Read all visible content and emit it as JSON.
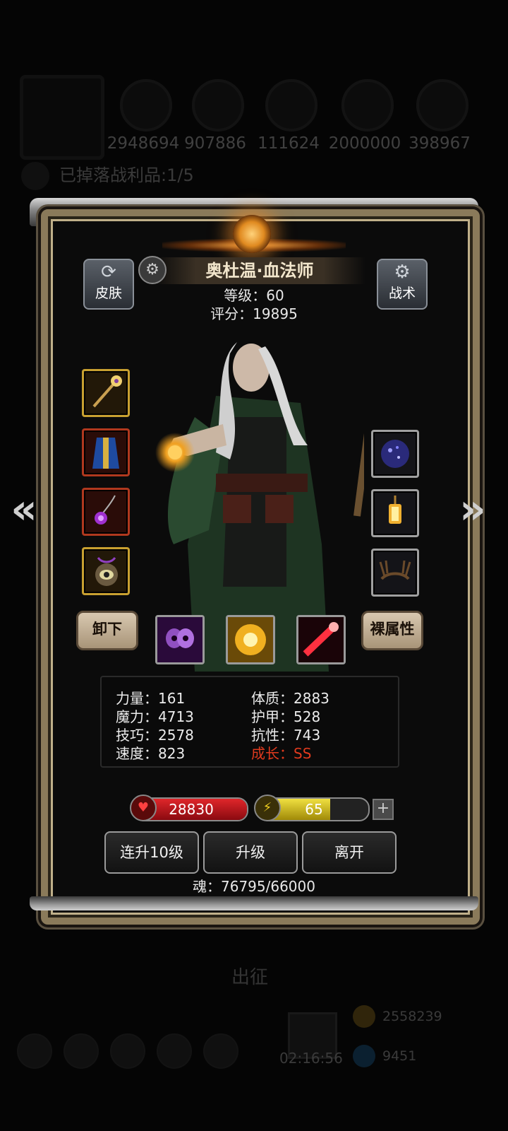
{
  "background": {
    "resources": [
      "2948694",
      "907886",
      "111624",
      "2000000",
      "398967"
    ],
    "loot_text": "已掉落战利品:1/5",
    "expedition": "出征",
    "timer": "02:16:56",
    "coins": "2558239",
    "gems": "9451"
  },
  "hero": {
    "name": "奥杜温·血法师",
    "level": "等级：60",
    "score": "评分：19895"
  },
  "buttons": {
    "skin": "皮肤",
    "tactics": "战术",
    "unequip": "卸下",
    "bare_attributes": "裸属性",
    "level_up_10": "连升10级",
    "level_up": "升级",
    "leave": "离开"
  },
  "stats": {
    "strength": "力量：161",
    "constitution": "体质：2883",
    "magic": "魔力：4713",
    "armor": "护甲：528",
    "skill": "技巧：2578",
    "resistance": "抗性：743",
    "speed": "速度：823",
    "growth": "成长：SS"
  },
  "bars": {
    "hp": "28830",
    "energy": "65",
    "energy_fraction": 0.65
  },
  "soul": "魂：76795/66000",
  "colors": {
    "hp": "#c0141a",
    "energy": "#d8c41c",
    "growth": "#e03a1e",
    "gold_border": "#c49a2a"
  },
  "icons": {
    "equipment_left": [
      "staff-icon",
      "robe-icon",
      "amulet-icon",
      "eye-charm-icon"
    ],
    "equipment_right": [
      "orb-icon",
      "lantern-icon",
      "antler-crown-icon"
    ],
    "skills": [
      "shadow-skull-skill-icon",
      "holy-burst-skill-icon",
      "blood-missile-skill-icon"
    ]
  }
}
